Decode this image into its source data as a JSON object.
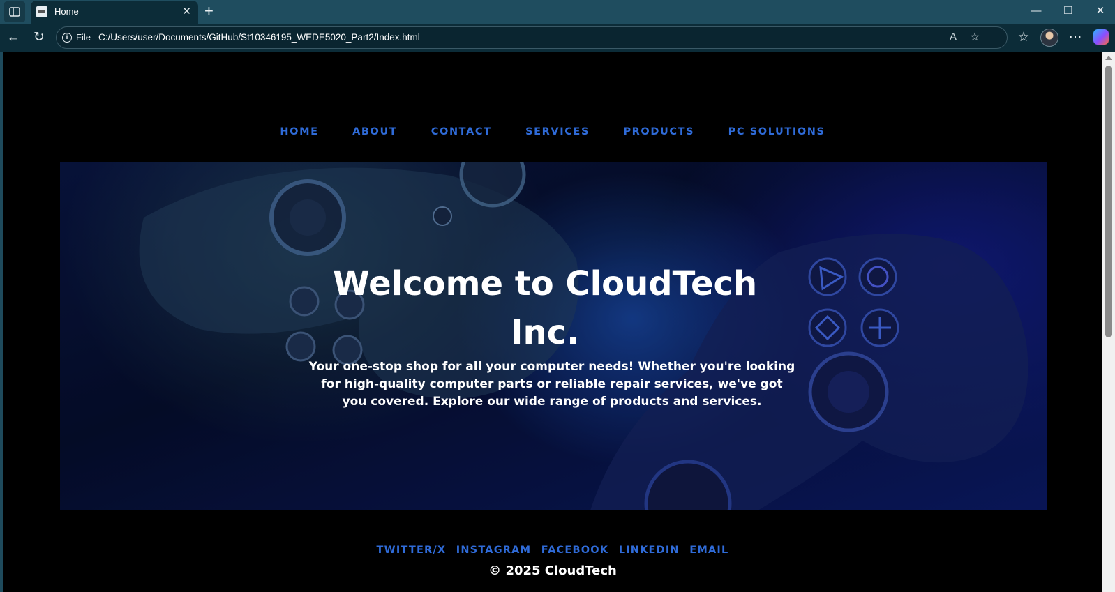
{
  "browser": {
    "tab": {
      "title": "Home"
    },
    "address": {
      "scheme_label": "File",
      "url": "C:/Users/user/Documents/GitHub/St10346195_WEDE5020_Part2/Index.html"
    }
  },
  "page": {
    "nav": [
      "HOME",
      "ABOUT",
      "CONTACT",
      "SERVICES",
      "PRODUCTS",
      "PC SOLUTIONS"
    ],
    "hero": {
      "title": "Welcome to CloudTech Inc.",
      "text": "Your one-stop shop for all your computer needs! Whether you're looking for high-quality computer parts or reliable repair services, we've got you covered. Explore our wide range of products and services."
    },
    "footer": {
      "links": [
        "TWITTER/X",
        "INSTAGRAM",
        "FACEBOOK",
        "LINKEDIN",
        "EMAIL"
      ],
      "copyright": "© 2025 CloudTech"
    }
  },
  "colors": {
    "link": "#2f6bd8",
    "page_bg": "#000000",
    "chrome": "#1f4d5f"
  },
  "icons": [
    "sidebar-icon",
    "close-icon",
    "plus-icon",
    "minimize-icon",
    "restore-icon",
    "back-icon",
    "refresh-icon",
    "info-icon",
    "read-aloud-icon",
    "star-icon",
    "favorites-icon",
    "more-icon",
    "copilot-icon"
  ]
}
